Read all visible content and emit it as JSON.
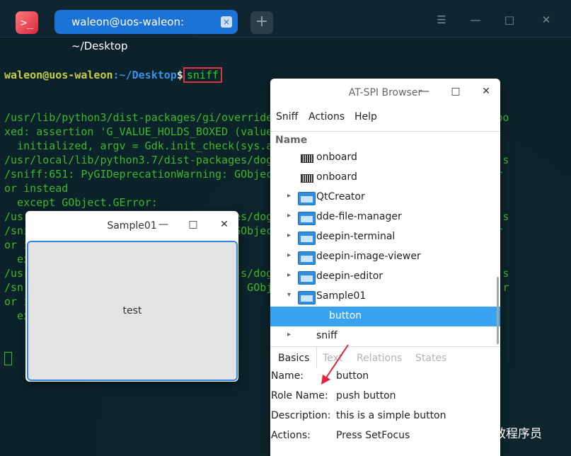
{
  "terminal": {
    "tab_title": "waleon@uos-waleon: ~/Desktop",
    "tab_close": "×",
    "add_tab": "+",
    "controls": {
      "menu": "☰",
      "minimize": "—",
      "maximize": "□",
      "close": "✕"
    },
    "prompt_user": "waleon@uos-waleon",
    "prompt_path": ":~/Desktop",
    "prompt_symbol": "$",
    "command": "sniff",
    "output_lines": [
      "/usr/lib/python3/dist-packages/gi/overrides/Gdk.py:461: Warning: g_value_set_bo",
      "xed: assertion 'G_VALUE_HOLDS_BOXED (value)' failed",
      "  initialized, argv = Gdk.init_check(sys.a",
      "/usr/local/lib/python3.7/dist-packages/dog                                    s",
      "/sniff:651: PyGIDeprecationWarning: GObjec                                   r",
      "or instead",
      "  except GObject.GError:",
      "/usr/local/lib/python3.7/dist-packages/dog                                    s",
      "/sniff:621: PyGIDeprecationWarning: GObjec                                   r",
      "or instead",
      "  except GObject.GError:",
      "/usr                                 s/dog                                    s",
      "/sn                                   GObjec                                  r",
      "or i",
      "  ex"
    ]
  },
  "sample_window": {
    "title": "Sample01",
    "minimize": "—",
    "maximize": "□",
    "close": "✕",
    "button_label": "test"
  },
  "atspi": {
    "title": "AT-SPI Browser",
    "minimize": "—",
    "maximize": "□",
    "close": "✕",
    "menu": [
      "Sniff",
      "Actions",
      "Help"
    ],
    "column_header": "Name",
    "tree": [
      {
        "label": "onboard",
        "icon": "keyboard-icon",
        "arrow": ""
      },
      {
        "label": "onboard",
        "icon": "keyboard-icon",
        "arrow": ""
      },
      {
        "label": "QtCreator",
        "icon": "folder-icon",
        "arrow": "▸"
      },
      {
        "label": "dde-file-manager",
        "icon": "folder-icon",
        "arrow": "▸"
      },
      {
        "label": "deepin-terminal",
        "icon": "folder-icon",
        "arrow": "▸"
      },
      {
        "label": "deepin-image-viewer",
        "icon": "folder-icon",
        "arrow": "▸"
      },
      {
        "label": "deepin-editor",
        "icon": "folder-icon",
        "arrow": "▸"
      },
      {
        "label": "Sample01",
        "icon": "folder-icon",
        "arrow": "▾"
      },
      {
        "label": "button",
        "icon": "",
        "arrow": "",
        "selected": true
      },
      {
        "label": "sniff",
        "icon": "",
        "arrow": "▸"
      }
    ],
    "tabs": [
      "Basics",
      "Text",
      "Relations",
      "States"
    ],
    "properties": [
      {
        "key": "Name:",
        "value": "button"
      },
      {
        "key": "Role Name:",
        "value": "push button"
      },
      {
        "key": "Description:",
        "value": "this is a simple button"
      },
      {
        "key": "Actions:",
        "value": "Press SetFocus"
      }
    ]
  },
  "watermark": "高效程序员",
  "colors": {
    "accent": "#1b73d8",
    "selection": "#3aa2f2",
    "highlight_box": "#e23344",
    "arrow": "#e8203a"
  }
}
